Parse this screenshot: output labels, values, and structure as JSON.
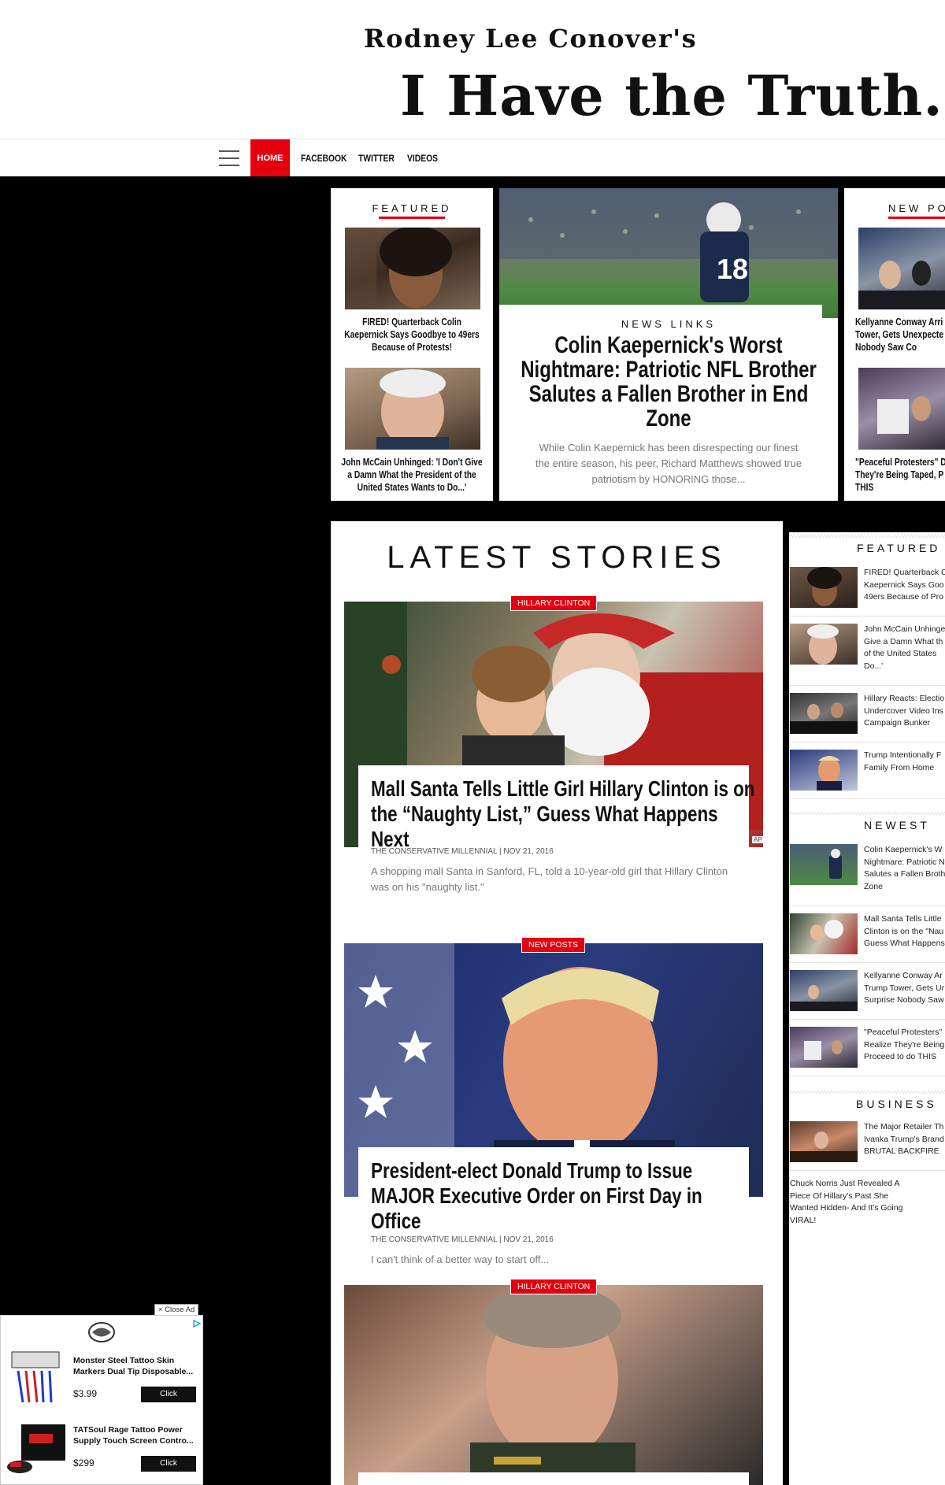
{
  "header": {
    "subtitle": "Rodney Lee Conover's",
    "title": "I Have the Truth.com"
  },
  "nav": {
    "items": [
      "HOME",
      "FACEBOOK",
      "TWITTER",
      "VIDEOS"
    ],
    "active": "HOME"
  },
  "featured": {
    "heading": "FEATURED",
    "items": [
      {
        "title": "FIRED! Quarterback Colin Kaepernick Says Goodbye to 49ers Because of Protests!"
      },
      {
        "title": "John McCain Unhinged: 'I Don't Give a Damn What the President of the United States Wants to Do...'"
      }
    ]
  },
  "hero": {
    "kicker": "NEWS LINKS",
    "title": "Colin Kaepernick's Worst Nightmare: Patriotic NFL Brother Salutes a Fallen Brother in End Zone",
    "excerpt": "While Colin Kaepernick has been disrespecting our finest the entire season, his peer, Richard Matthews showed true patriotism by HONORING those..."
  },
  "new_posts": {
    "heading": "NEW POS",
    "items": [
      {
        "title": "Kellyanne Conway Arri Tower, Gets Unexpecte Nobody Saw Co"
      },
      {
        "title": "\"Peaceful Protesters\" D They're Being Taped, P THIS"
      }
    ]
  },
  "latest": {
    "heading": "LATEST STORIES",
    "stories": [
      {
        "badge": "HILLARY CLINTON",
        "title": "Mall Santa Tells Little Girl Hillary Clinton is on the “Naughty List,” Guess What Happens Next",
        "meta": "THE CONSERVATIVE MILLENNIAL | Nov 21, 2016",
        "excerpt": "A shopping mall Santa in Sanford, FL, told a 10-year-old girl that Hillary Clinton was on his \"naughty list.\"",
        "credit": "AP"
      },
      {
        "badge": "NEW POSTS",
        "title": "President-elect Donald Trump to Issue MAJOR Executive Order on First Day in Office",
        "meta": "THE CONSERVATIVE MILLENNIAL | Nov 21, 2016",
        "excerpt": "I can't think of a better way to start off..."
      },
      {
        "badge": "HILLARY CLINTON"
      }
    ]
  },
  "sidebar": {
    "featured_heading": "FEATURED",
    "featured": [
      {
        "title": "FIRED! Quarterback C Kaepernick Says Goo 49ers Because of Pro"
      },
      {
        "title": "John McCain Unhinge Give a Damn What th of the United States Do...'"
      },
      {
        "title": "Hillary Reacts: Electio Undercover Video Ins Campaign Bunker"
      },
      {
        "title": "Trump Intentionally F Family From Home"
      }
    ],
    "newest_heading": "NEWEST",
    "newest": [
      {
        "title": "Colin Kaepernick's W Nightmare: Patriotic N Salutes a Fallen Broth Zone"
      },
      {
        "title": "Mall Santa Tells Little Clinton is on the \"Nau Guess What Happens"
      },
      {
        "title": "Kellyanne Conway Ar Trump Tower, Gets Ur Surprise Nobody Saw"
      },
      {
        "title": "\"Peaceful Protesters\" Realize They're Being Proceed to do THIS"
      }
    ],
    "business_heading": "BUSINESS",
    "business": [
      {
        "title": "The Major Retailer Th Ivanka Trump's Brand BRUTAL BACKFIRE"
      }
    ],
    "extra": "Chuck Norris Just Revealed A Piece Of Hillary's Past She Wanted Hidden- And It's Going VIRAL!"
  },
  "ad": {
    "close_label": "× Close Ad",
    "items": [
      {
        "title": "Monster Steel Tattoo Skin Markers Dual Tip Disposable...",
        "price": "$3.99",
        "button": "Click"
      },
      {
        "title": "TATSoul Rage Tattoo Power Supply Touch Screen Contro...",
        "price": "$299",
        "button": "Click"
      }
    ]
  }
}
